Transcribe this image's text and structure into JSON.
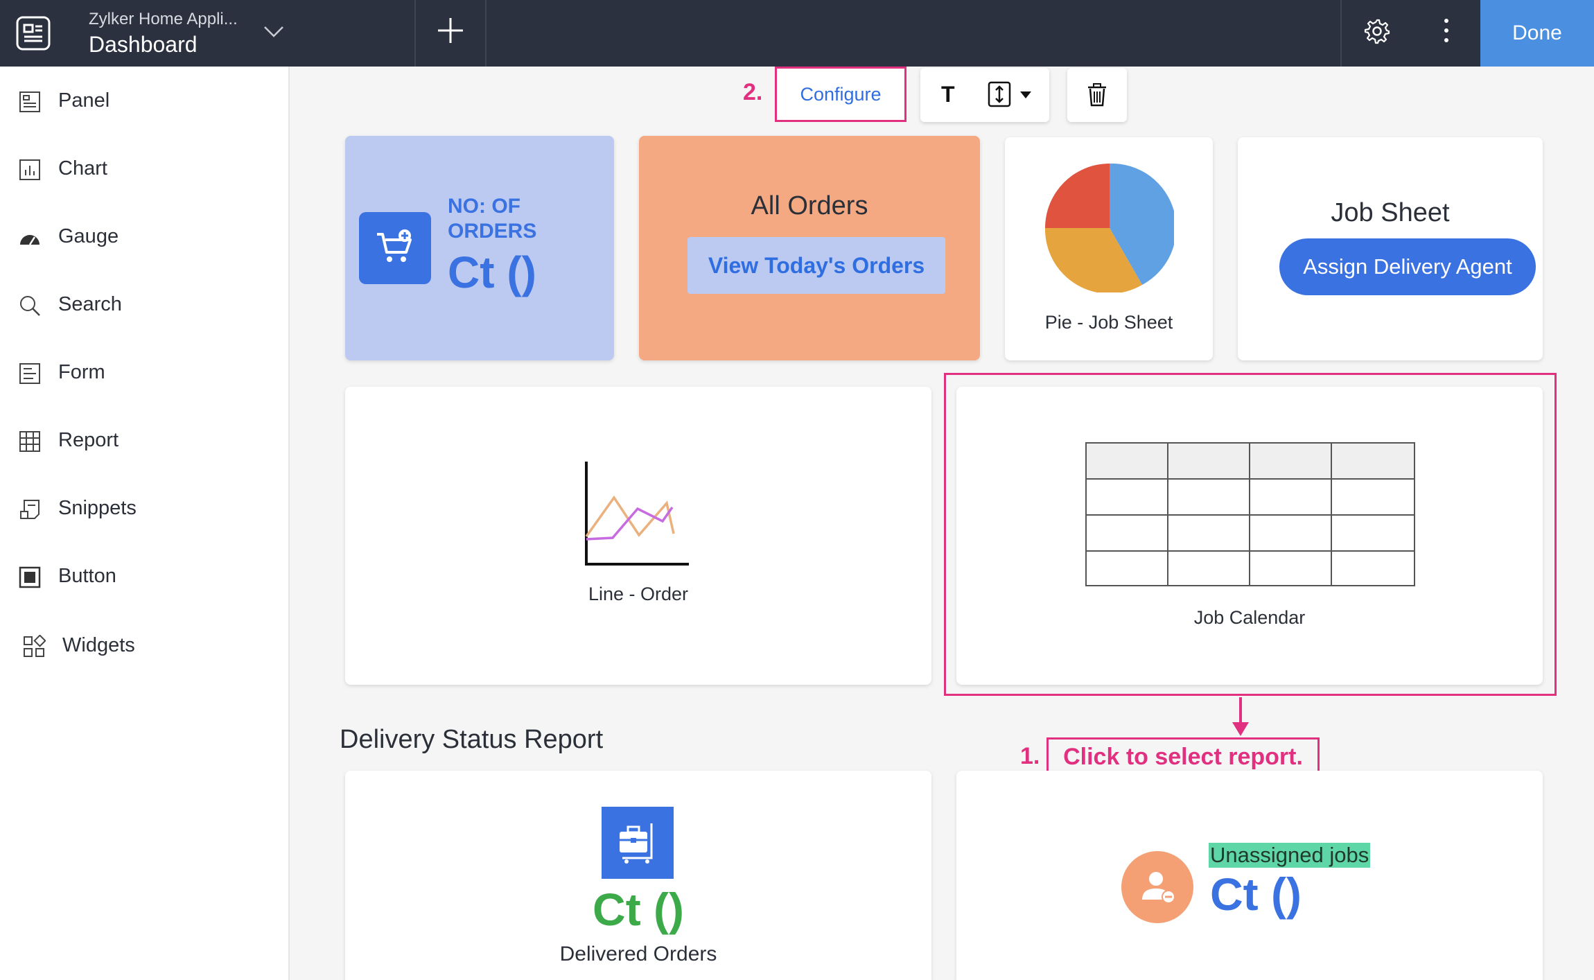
{
  "header": {
    "app_name": "Zylker Home Appli...",
    "page_title": "Dashboard",
    "done_label": "Done"
  },
  "sidebar": {
    "items": [
      {
        "label": "Panel",
        "icon": "panel-icon"
      },
      {
        "label": "Chart",
        "icon": "chart-icon"
      },
      {
        "label": "Gauge",
        "icon": "gauge-icon"
      },
      {
        "label": "Search",
        "icon": "search-icon"
      },
      {
        "label": "Form",
        "icon": "form-icon"
      },
      {
        "label": "Report",
        "icon": "report-icon"
      },
      {
        "label": "Snippets",
        "icon": "snippets-icon"
      },
      {
        "label": "Button",
        "icon": "button-icon"
      },
      {
        "label": "Widgets",
        "icon": "widgets-icon"
      }
    ]
  },
  "toolbar": {
    "step_number": "2.",
    "configure_label": "Configure",
    "text_tool_label": "T"
  },
  "cards": {
    "orders_count": {
      "label": "NO: OF ORDERS",
      "value": "Ct ()"
    },
    "all_orders": {
      "title": "All Orders",
      "button_label": "View Today's Orders"
    },
    "pie": {
      "label": "Pie - Job Sheet"
    },
    "job_sheet": {
      "title": "Job Sheet",
      "button_label": "Assign Delivery Agent"
    },
    "line": {
      "label": "Line - Order"
    },
    "calendar": {
      "label": "Job Calendar"
    }
  },
  "annotation": {
    "step_number": "1.",
    "instruction": "Click to select report."
  },
  "section": {
    "title": "Delivery Status Report"
  },
  "bottom_cards": {
    "delivered": {
      "value": "Ct ()",
      "label": "Delivered Orders"
    },
    "unassigned": {
      "label": "Unassigned jobs",
      "value": "Ct ()"
    }
  },
  "colors": {
    "topbar": "#2c3140",
    "accent": "#3a72e1",
    "done_button": "#4b8fe1",
    "highlight": "#e0307f",
    "orders_card": "#bcc9f1",
    "all_orders_card": "#f4a983",
    "delivered_value": "#3daa4a",
    "unassigned_highlight": "#5fd6a6"
  }
}
